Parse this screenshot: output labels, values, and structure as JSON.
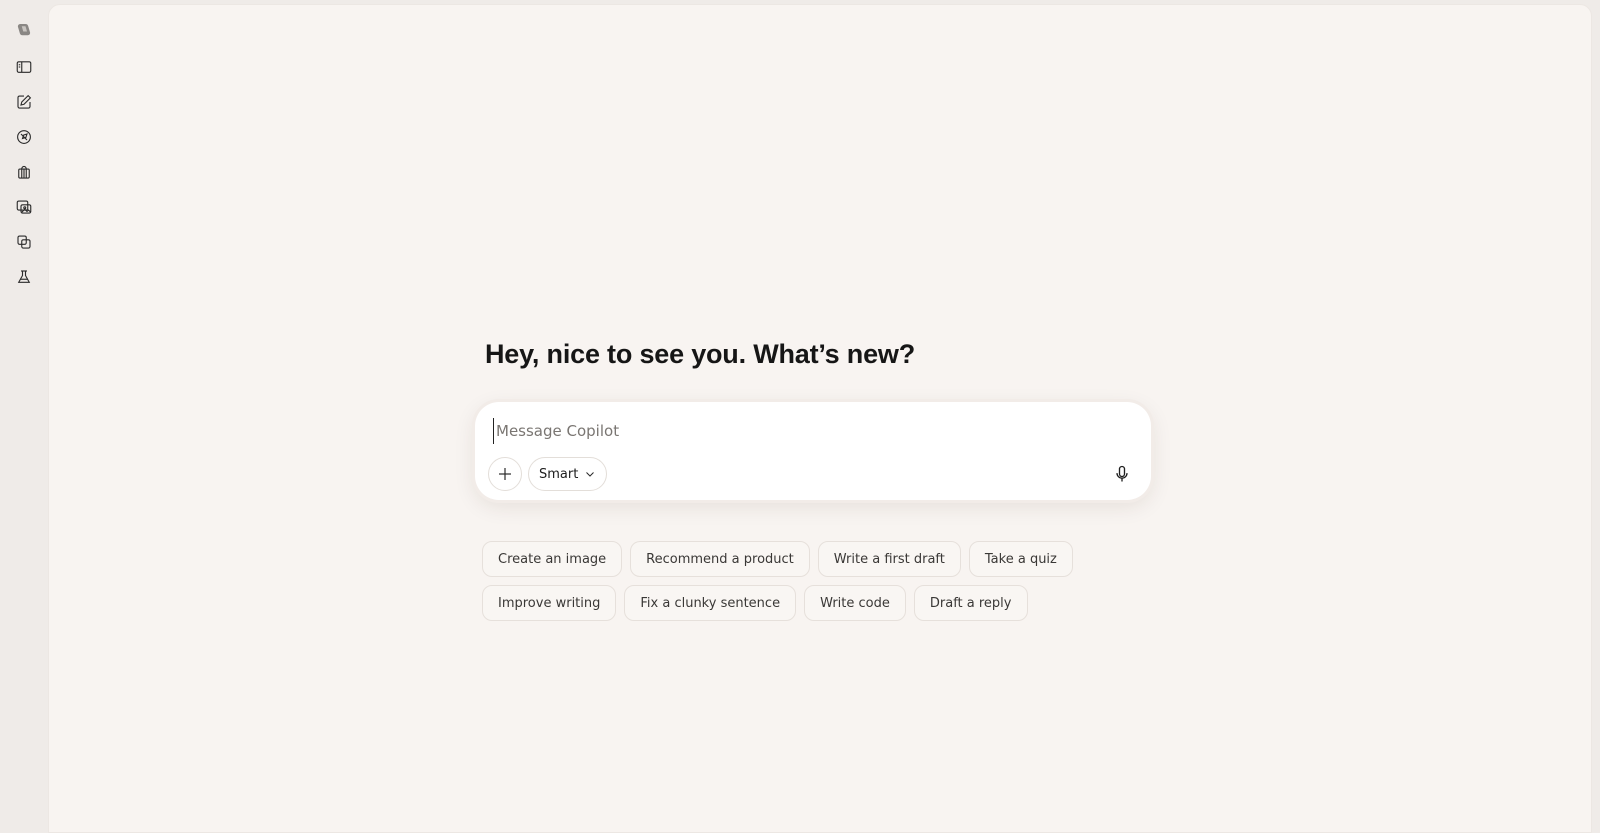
{
  "sidebar": {
    "items": [
      {
        "name": "copilot-logo-icon"
      },
      {
        "name": "sidebar-toggle-icon"
      },
      {
        "name": "new-chat-icon"
      },
      {
        "name": "discover-icon"
      },
      {
        "name": "gift-icon"
      },
      {
        "name": "images-icon"
      },
      {
        "name": "pages-icon"
      },
      {
        "name": "labs-icon"
      }
    ]
  },
  "main": {
    "greeting": "Hey, nice to see you. What’s new?",
    "composer": {
      "placeholder": "Message Copilot",
      "value": "",
      "mode_label": "Smart"
    },
    "suggestions": {
      "row1": [
        "Create an image",
        "Recommend a product",
        "Write a first draft",
        "Take a quiz"
      ],
      "row2": [
        "Improve writing",
        "Fix a clunky sentence",
        "Write code",
        "Draft a reply"
      ]
    }
  },
  "colors": {
    "rail_bg": "#efebe8",
    "canvas_bg": "#f8f4f1",
    "composer_bg": "#ffffff",
    "chip_border": "#e6e0db"
  }
}
